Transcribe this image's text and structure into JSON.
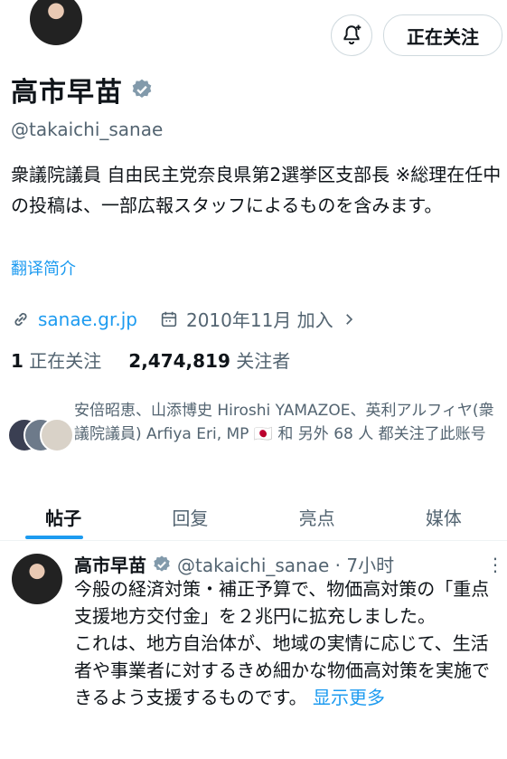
{
  "header": {
    "follow_label": "正在关注",
    "bell_icon": "bell-plus-icon"
  },
  "profile": {
    "name": "高市早苗",
    "handle": "@takaichi_sanae",
    "bio": "衆議院議員 自由民主党奈良県第2選挙区支部長 ※総理在任中の投稿は、一部広報スタッフによるものを含みます。",
    "translate_label": "翻译简介",
    "website": "sanae.gr.jp",
    "joined": "2010年11月 加入",
    "following_count": "1",
    "following_label": "正在关注",
    "followers_count": "2,474,819",
    "followers_label": "关注者",
    "followed_by_text": "安倍昭恵、山添博史 Hiroshi YAMAZOE、英利アルフィヤ(衆議院議員) Arfiya Eri, MP 🇯🇵 和 另外 68 人 都关注了此账号"
  },
  "tabs": [
    {
      "label": "帖子",
      "active": true
    },
    {
      "label": "回复",
      "active": false
    },
    {
      "label": "亮点",
      "active": false
    },
    {
      "label": "媒体",
      "active": false
    }
  ],
  "post": {
    "name": "高市早苗",
    "handle_time": "@takaichi_sanae · 7小时",
    "text": "今般の経済対策・補正予算で、物価高対策の「重点支援地方交付金」を２兆円に拡充しました。\nこれは、地方自治体が、地域の実情に応じて、生活者や事業者に対するきめ細かな物価高対策を実施できるよう支援するものです。",
    "show_more": "显示更多"
  },
  "colors": {
    "accent": "#1d9bf0",
    "text": "#0f1419",
    "secondary": "#536471"
  }
}
